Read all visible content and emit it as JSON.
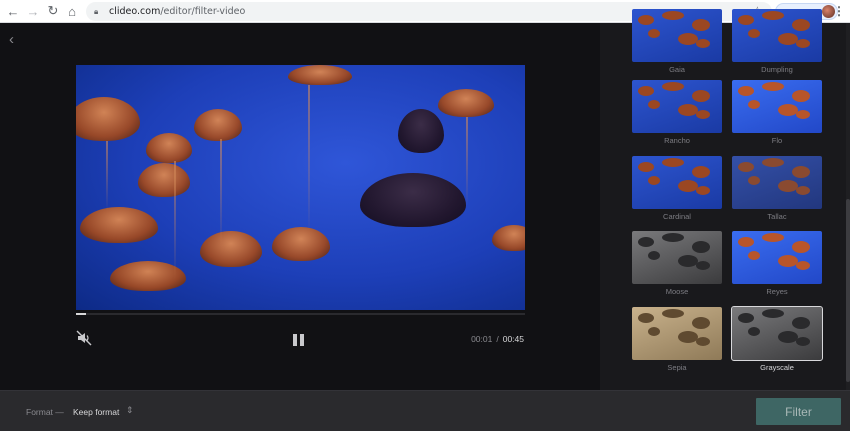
{
  "browser": {
    "url_host": "clideo.com",
    "url_path": "/editor/filter-video",
    "profile_status": "Paused"
  },
  "player": {
    "current_time": "00:01",
    "separator": "/",
    "total_time": "00:45",
    "progress": 0.022,
    "muted": true
  },
  "filters": [
    {
      "label": "Gaia",
      "style": "normal"
    },
    {
      "label": "Dumpling",
      "style": "normal"
    },
    {
      "label": "Rancho",
      "style": "normal"
    },
    {
      "label": "Flo",
      "style": "bright"
    },
    {
      "label": "Cardinal",
      "style": "normal"
    },
    {
      "label": "Tallac",
      "style": "muted"
    },
    {
      "label": "Moose",
      "style": "grayscale"
    },
    {
      "label": "Reyes",
      "style": "bright"
    },
    {
      "label": "Sepia",
      "style": "sepia"
    },
    {
      "label": "Grayscale",
      "style": "grayscale"
    }
  ],
  "selected_filter": "Grayscale",
  "footer": {
    "format_label": "Format —",
    "format_value": "Keep format",
    "filter_button": "Filter"
  },
  "colors": {
    "accent_button": "#3e6664",
    "video_blue": "#2f56d8",
    "jellyfish_orange": "#a2491d"
  }
}
